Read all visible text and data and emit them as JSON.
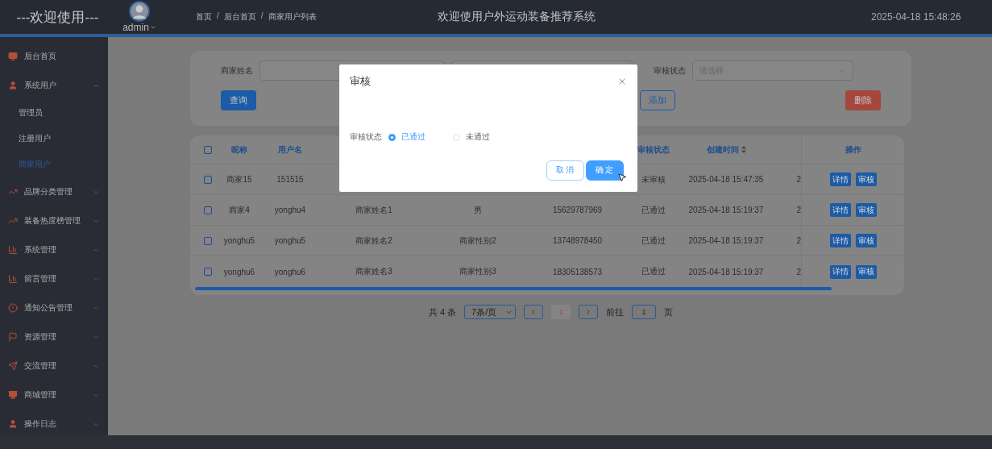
{
  "header": {
    "brand": "---欢迎使用---",
    "user": "admin",
    "breadcrumb": [
      "首页",
      "后台首页",
      "商家用户列表"
    ],
    "breadcrumb_separator": "/",
    "title": "欢迎使用户外运动装备推荐系统",
    "datetime": "2025-04-18 15:48:26"
  },
  "sidebar": {
    "items": [
      {
        "label": "后台首页"
      },
      {
        "label": "系统用户",
        "expanded": true,
        "children": [
          {
            "label": "管理员",
            "selected": false
          },
          {
            "label": "注册用户",
            "selected": false
          },
          {
            "label": "商家用户",
            "selected": true
          }
        ]
      },
      {
        "label": "品牌分类管理",
        "expanded": false
      },
      {
        "label": "装备热度榜管理",
        "expanded": false
      },
      {
        "label": "系统管理",
        "expanded": false
      },
      {
        "label": "留言管理",
        "expanded": false
      },
      {
        "label": "通知公告管理",
        "expanded": false
      },
      {
        "label": "资源管理",
        "expanded": false
      },
      {
        "label": "交流管理",
        "expanded": false
      },
      {
        "label": "商城管理",
        "expanded": false
      },
      {
        "label": "操作日志",
        "expanded": false
      }
    ]
  },
  "search": {
    "fields": [
      {
        "kind": "input",
        "label": "商家姓名"
      },
      {
        "kind": "input"
      },
      {
        "kind": "select",
        "label": "审核状态",
        "placeholder": "请选择"
      }
    ],
    "buttons": [
      {
        "label": "查询",
        "kind": "primary"
      },
      {
        "label": "添加",
        "kind": "outline"
      },
      {
        "label": "删除",
        "kind": "danger"
      }
    ]
  },
  "table": {
    "all_checked": false,
    "columns": [
      {
        "label": "昵称"
      },
      {
        "label": "用户名"
      },
      {},
      {},
      {},
      {
        "label": "审核状态"
      },
      {
        "label": "创建时间",
        "sortable": true
      },
      {},
      {
        "label": "操作"
      }
    ],
    "rows": [
      {
        "checked": false,
        "cells": [
          "商家15",
          "151515",
          null,
          null,
          null,
          "未审核",
          "2025-04-18 15:47:35",
          "2"
        ],
        "actions": [
          "详情",
          "审核"
        ]
      },
      {
        "checked": false,
        "cells": [
          "商家4",
          "yonghu4",
          "商家姓名1",
          "男",
          "15629787969",
          "已通过",
          "2025-04-18 15:19:37",
          "2"
        ],
        "actions": [
          "详情",
          "审核"
        ]
      },
      {
        "checked": false,
        "cells": [
          "yonghu5",
          "yonghu5",
          "商家姓名2",
          "商家性别2",
          "13748978450",
          "已通过",
          "2025-04-18 15:19:37",
          "2"
        ],
        "actions": [
          "详情",
          "审核"
        ]
      },
      {
        "checked": false,
        "cells": [
          "yonghu6",
          "yonghu6",
          "商家姓名3",
          "商家性别3",
          "18305138573",
          "已通过",
          "2025-04-18 15:19:37",
          "2"
        ],
        "actions": [
          "详情",
          "审核"
        ]
      }
    ]
  },
  "pagination": {
    "total": "共 4 条",
    "page_size": "7条/页",
    "pages": [
      {
        "label": "1",
        "selected": true
      }
    ],
    "goto_label": "前往",
    "goto_value": "1",
    "goto_suffix": "页"
  },
  "modal": {
    "title": "审核",
    "field_label": "审核状态",
    "options": [
      {
        "label": "已通过",
        "selected": true
      },
      {
        "label": "未通过",
        "selected": false
      }
    ],
    "buttons": [
      {
        "label": "取消",
        "kind": "default"
      },
      {
        "label": "确定",
        "kind": "primary"
      }
    ]
  }
}
